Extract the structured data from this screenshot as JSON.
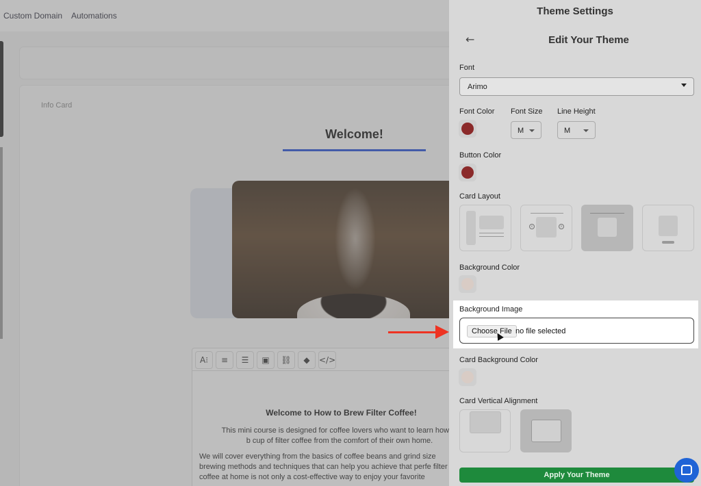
{
  "topnav": {
    "items": [
      "Custom Domain",
      "Automations"
    ]
  },
  "content": {
    "card_label": "Info Card",
    "welcome_title": "Welcome!",
    "editor": {
      "title": "Welcome to How to Brew Filter Coffee!",
      "paragraph1": "This mini course is designed for coffee lovers who want to learn how to b cup of filter coffee from the comfort of their own home.",
      "paragraph2": "We will cover everything from the basics of coffee beans and grind size brewing methods and techniques that can help you achieve that perfe filter coffee at home is not only a cost-effective way to enjoy your favorite",
      "toolbar_icons": [
        "font-size-icon",
        "align-icon",
        "ordered-list-icon",
        "image-icon",
        "link-icon",
        "eraser-icon",
        "code-icon"
      ]
    }
  },
  "drawer": {
    "header": "Theme Settings",
    "subheader": "Edit Your Theme",
    "font": {
      "label": "Font",
      "value": "Arimo"
    },
    "font_color": {
      "label": "Font Color",
      "color": "#8b2a2a"
    },
    "font_size": {
      "label": "Font Size",
      "value": "M"
    },
    "line_height": {
      "label": "Line Height",
      "value": "M"
    },
    "button_color": {
      "label": "Button Color",
      "color": "#8b2a2a"
    },
    "card_layout": {
      "label": "Card Layout",
      "selected_index": 2
    },
    "background_color": {
      "label": "Background Color",
      "color": "#e6d7cf"
    },
    "background_image": {
      "label": "Background Image",
      "button": "Choose File",
      "status": "no file selected"
    },
    "card_background_color": {
      "label": "Card Background Color",
      "color": "#e6d7cf"
    },
    "card_vertical_alignment": {
      "label": "Card Vertical Alignment",
      "selected_index": 1
    },
    "apply_button": "Apply Your Theme"
  },
  "colors": {
    "accent": "#1f4bd8",
    "apply": "#1e8a3c",
    "arrow": "#ee3322",
    "chat": "#1f63d6"
  }
}
